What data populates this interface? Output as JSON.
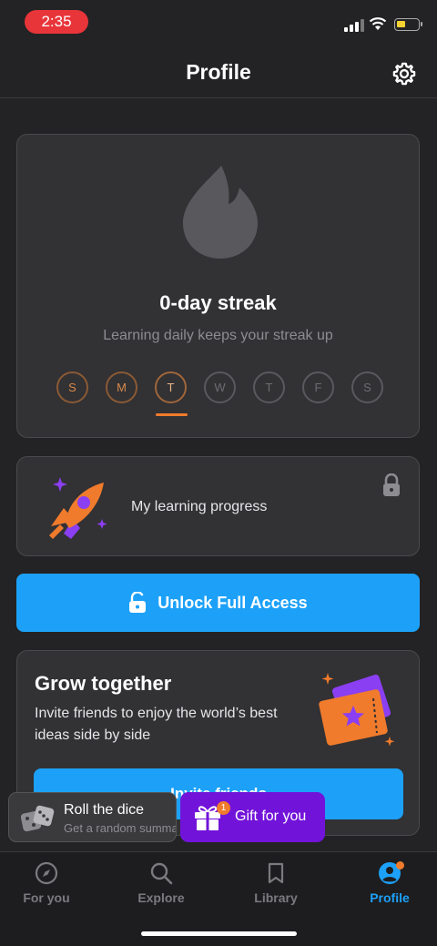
{
  "status_bar": {
    "time": "2:35"
  },
  "header": {
    "title": "Profile"
  },
  "streak": {
    "title": "0-day streak",
    "subtitle": "Learning daily keeps your streak up",
    "days": [
      "S",
      "M",
      "T",
      "W",
      "T",
      "F",
      "S"
    ]
  },
  "progress": {
    "label": "My learning progress"
  },
  "unlock": {
    "label": "Unlock Full Access"
  },
  "grow": {
    "title": "Grow together",
    "text": "Invite friends to enjoy the world’s best ideas side by side",
    "invite_label": "Invite friends"
  },
  "dice": {
    "title": "Roll the dice",
    "subtitle": "Get a random summary"
  },
  "gift": {
    "label": "Gift for you",
    "badge": "1"
  },
  "nav": {
    "for_you": "For you",
    "explore": "Explore",
    "library": "Library",
    "profile": "Profile"
  },
  "colors": {
    "accent": "#1da1f8",
    "streak_orange": "#f07b2c",
    "gift_purple": "#7213d9"
  }
}
